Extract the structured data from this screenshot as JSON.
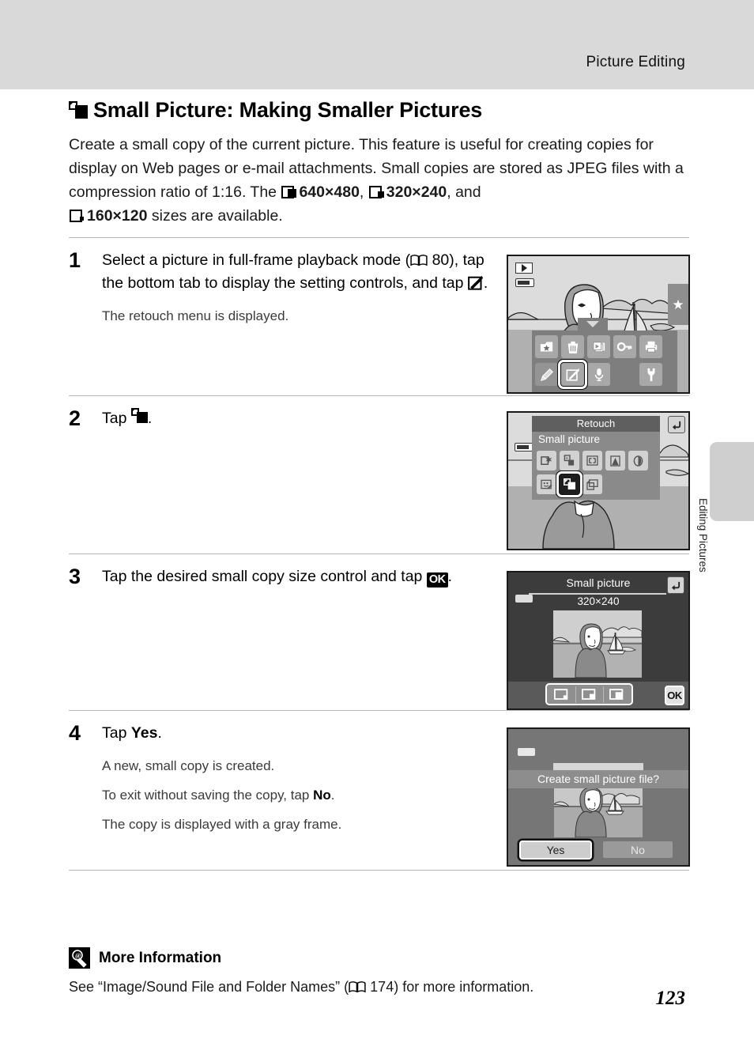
{
  "header": {
    "title": "Picture Editing"
  },
  "side_tab": {
    "label": "Editing Pictures"
  },
  "page": {
    "number": "123"
  },
  "chapter": {
    "icon": "small-picture-icon",
    "title": "Small Picture: Making Smaller Pictures"
  },
  "intro": {
    "text_1": "Create a small copy of the current picture. This feature is useful for creating copies for display on Web pages or e-mail attachments. Small copies are stored as JPEG files with a compression ratio of 1:16. The ",
    "size_640": "640×480",
    "sep_1": ", ",
    "size_320": "320×240",
    "sep_2": ", and ",
    "size_160": "160×120",
    "text_2": " sizes are available."
  },
  "steps": [
    {
      "number": "1",
      "lead_a": "Select a picture in full-frame playback mode (",
      "lead_ref": " 80), tap the bottom tab to display the setting controls, and tap ",
      "lead_b": ".",
      "sub": "The retouch menu is displayed."
    },
    {
      "number": "2",
      "lead_a": "Tap ",
      "lead_b": "."
    },
    {
      "number": "3",
      "lead_a": "Tap the desired small copy size control and tap ",
      "ok_label": "OK",
      "lead_b": "."
    },
    {
      "number": "4",
      "lead_a": "Tap ",
      "lead_bold": "Yes",
      "lead_b": ".",
      "sub_1": "A new, small copy is created.",
      "sub_2a": "To exit without saving the copy, tap ",
      "sub_2b": "No",
      "sub_2c": ".",
      "sub_3": "The copy is displayed with a gray frame."
    }
  ],
  "screens": {
    "step1": {
      "hud_playback": "playback-mode-icon",
      "hud_battery": "battery-icon",
      "hud_favorite": "★",
      "menu_row1": [
        "★",
        "trash-icon",
        "slideshow-icon",
        "key-icon",
        "print-icon"
      ],
      "menu_row2": [
        "pencil-icon",
        "retouch-icon",
        "mic-icon",
        "wrench-icon"
      ],
      "selected": "retouch-icon"
    },
    "step2": {
      "title": "Retouch",
      "subtitle": "Small picture",
      "back_icon": "back-arrow-icon",
      "row1_icons": [
        "quick-retouch-icon",
        "d-lighting-icon",
        "skin-softening-icon",
        "filter-effects-icon",
        "soft-portrait-icon"
      ],
      "row2_icons": [
        "glamour-retouch-icon",
        "small-picture-icon",
        "crop-icon"
      ],
      "selected": "small-picture-icon"
    },
    "step3": {
      "title": "Small picture",
      "size": "320×240",
      "back_icon": "back-arrow-icon",
      "size_controls": [
        "160×120",
        "320×240",
        "640×480"
      ],
      "ok_label": "OK"
    },
    "step4": {
      "prompt": "Create small picture file?",
      "yes_label": "Yes",
      "no_label": "No",
      "battery_icon": "battery-icon"
    }
  },
  "note": {
    "icon": "more-information-icon",
    "heading": "More Information",
    "body": "See “Image/Sound File and Folder Names” (",
    "ref": " 174) for more information."
  },
  "colors": {
    "header_band": "#d9d9d9",
    "side_tab": "#cfcfcf",
    "rule": "#b9b9b9",
    "screen_border": "#1a1a1a"
  }
}
